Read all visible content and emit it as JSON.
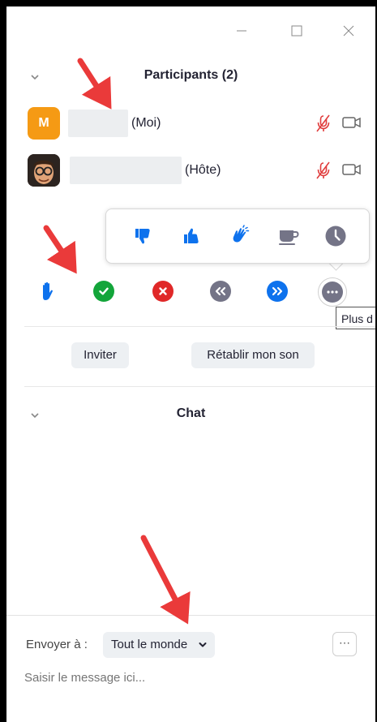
{
  "window": {
    "controls": {
      "minimize": "—",
      "maximize": "☐",
      "close": "✕"
    }
  },
  "participants": {
    "title": "Participants (2)",
    "items": [
      {
        "avatar_letter": "M",
        "suffix": "(Moi)"
      },
      {
        "avatar_letter": "",
        "suffix": "(Hôte)"
      }
    ]
  },
  "reactions": [
    "thumbs-down-icon",
    "thumbs-up-icon",
    "clap-icon",
    "coffee-icon",
    "clock-icon"
  ],
  "feedback": {
    "more_tooltip": "Plus d"
  },
  "actions": {
    "invite": "Inviter",
    "unmute": "Rétablir mon son"
  },
  "chat": {
    "title": "Chat",
    "send_to_label": "Envoyer à :",
    "recipient": "Tout le monde",
    "more_button": "⋯",
    "placeholder": "Saisir le message ici..."
  },
  "colors": {
    "accent_blue": "#0e72ed",
    "green": "#13a53a",
    "red": "#e02828",
    "gray": "#747487",
    "orange_avatar": "#f59a14",
    "arrow_red": "#ea3a3a"
  }
}
